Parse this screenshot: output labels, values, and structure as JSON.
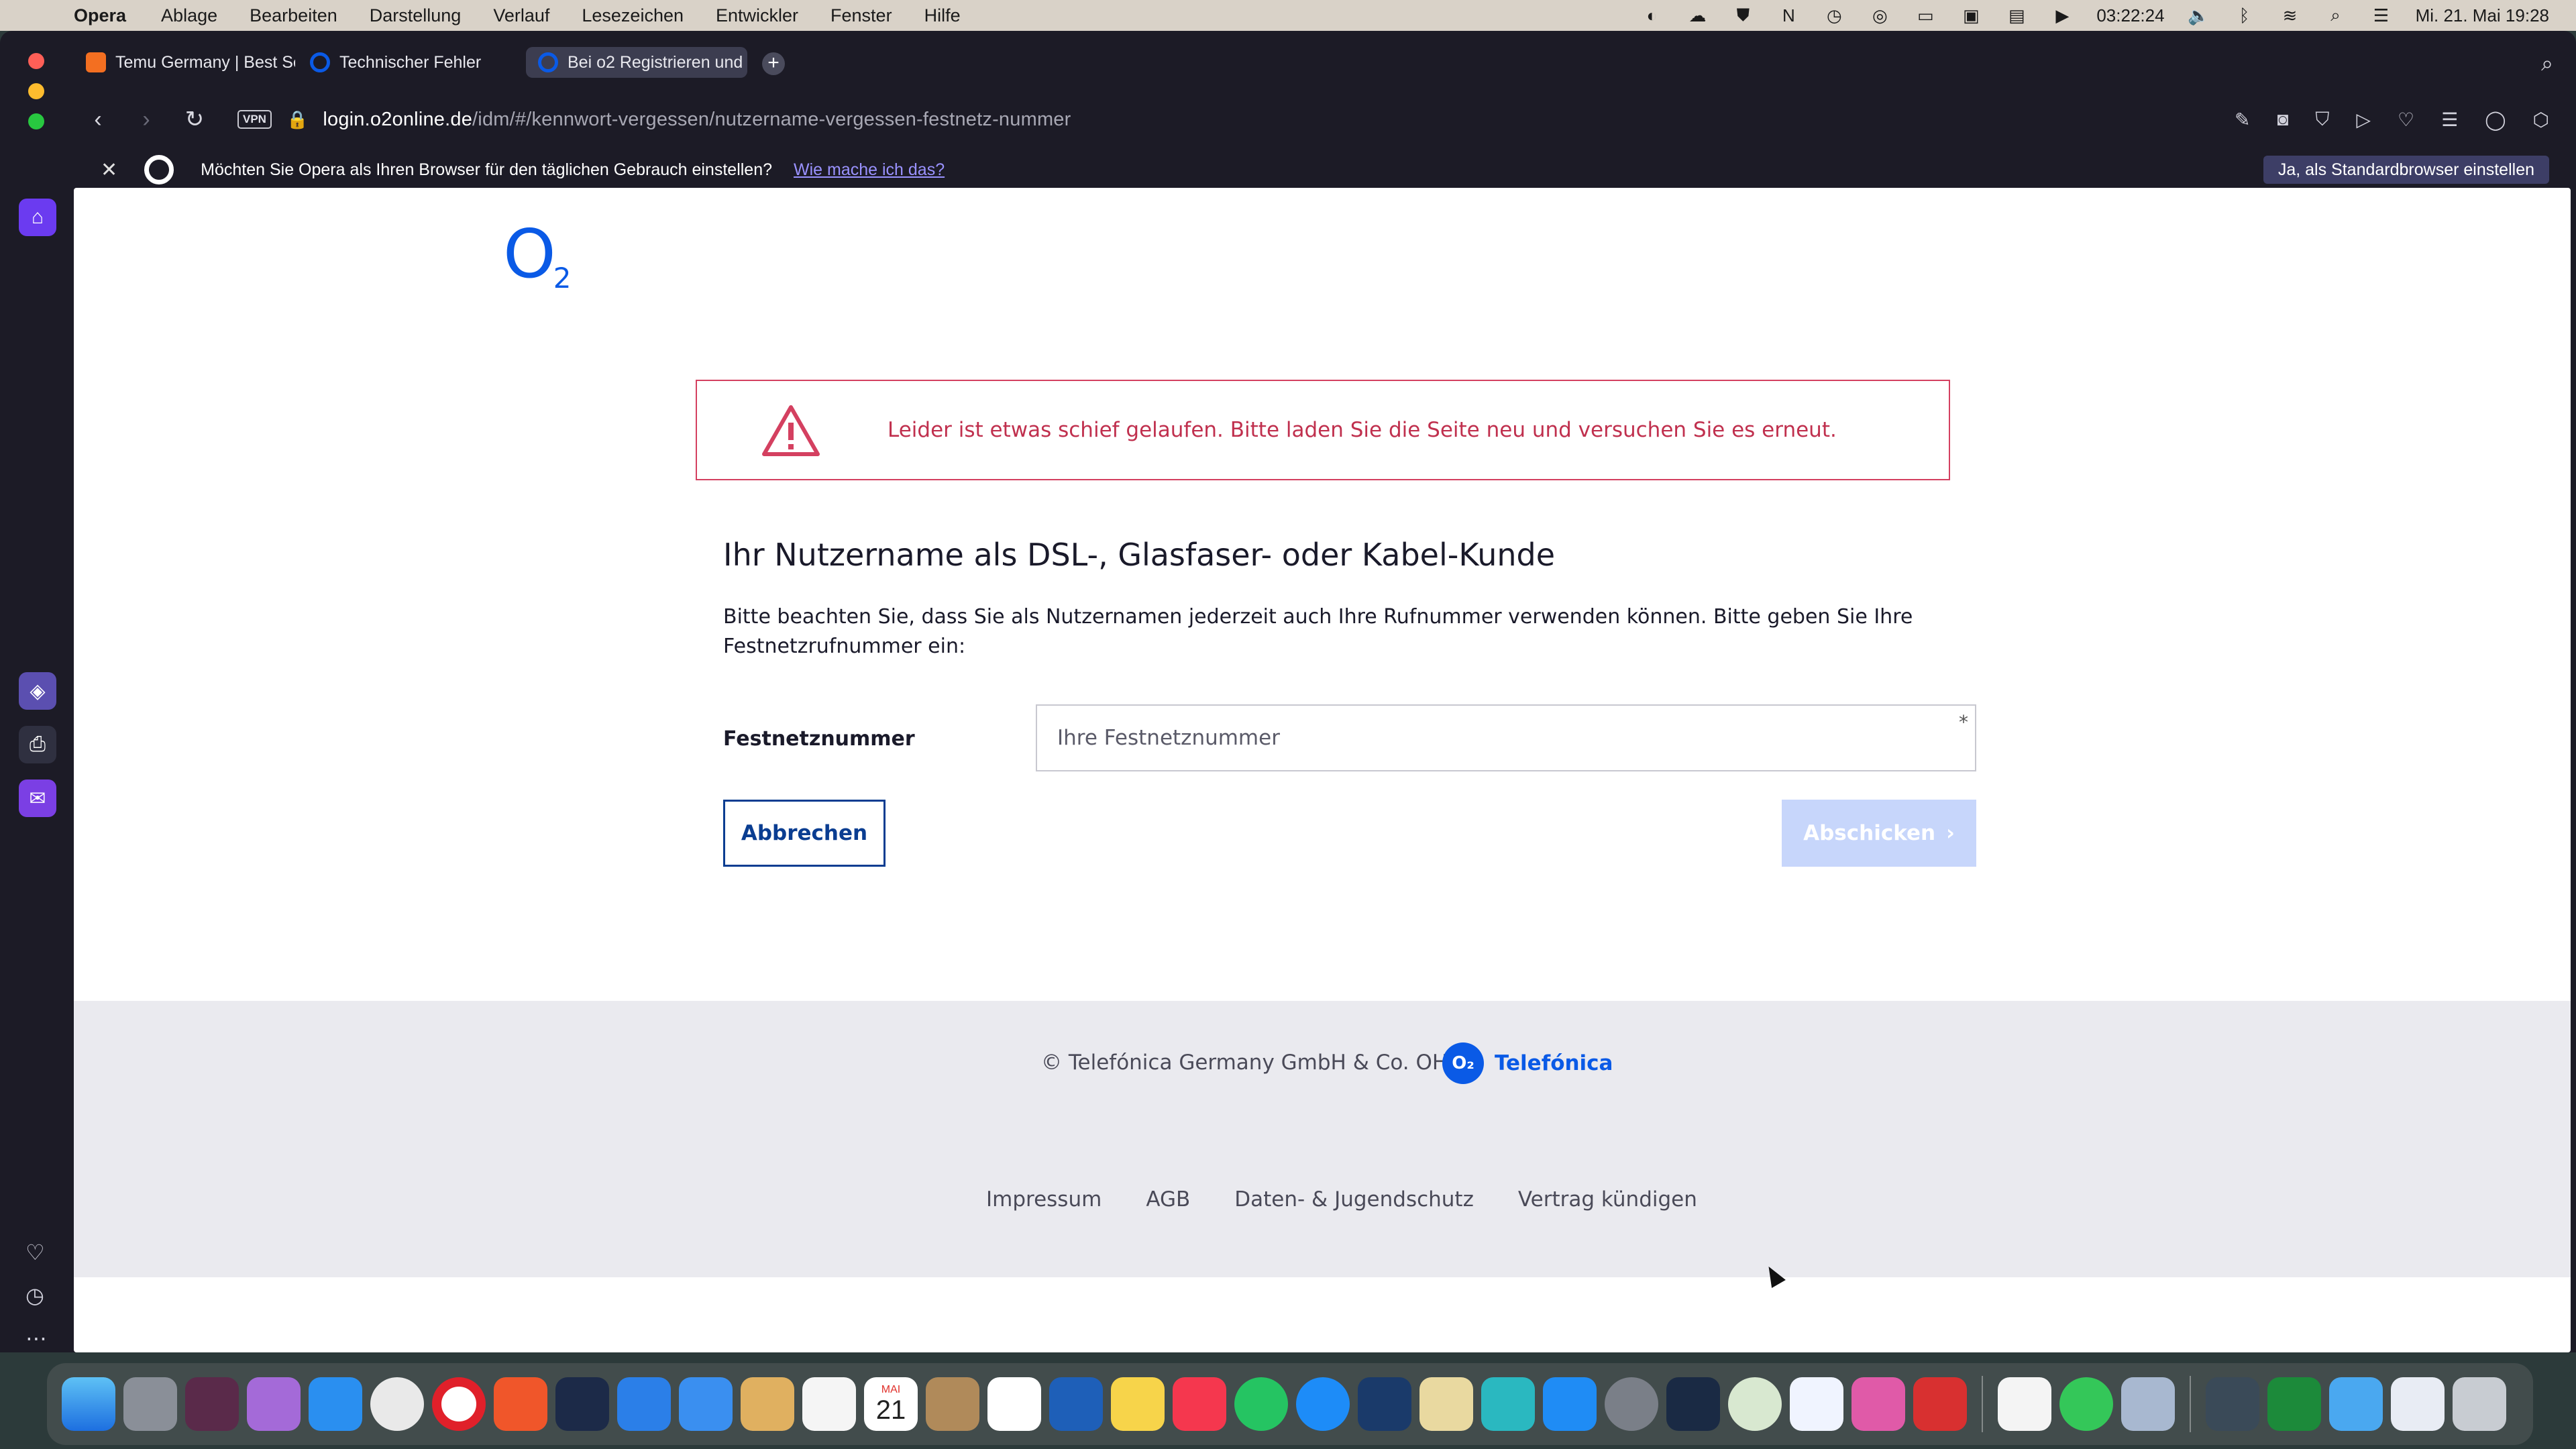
{
  "menubar": {
    "app_name": "Opera",
    "items": [
      "Ablage",
      "Bearbeiten",
      "Darstellung",
      "Verlauf",
      "Lesezeichen",
      "Entwickler",
      "Fenster",
      "Hilfe"
    ],
    "timer": "03:22:24",
    "clock": "Mi. 21. Mai  19:28"
  },
  "tabs": [
    {
      "title": "Temu Germany | Best Se",
      "favicon_color": "#f36f21"
    },
    {
      "title": "Technischer Fehler",
      "favicon_color": "#0a5ae6"
    },
    {
      "title": "Bei o2 Registrieren und",
      "favicon_color": "#0a5ae6"
    }
  ],
  "address": {
    "vpn_label": "VPN",
    "url_host": "login.o2online.de",
    "url_path": "/idm/#/kennwort-vergessen/nutzername-vergessen-festnetz-nummer"
  },
  "infobar": {
    "message": "Möchten Sie Opera als Ihren Browser für den täglichen Gebrauch einstellen?",
    "link": "Wie mache ich das?",
    "button": "Ja, als Standardbrowser einstellen"
  },
  "page": {
    "error_message": "Leider ist etwas schief gelaufen. Bitte laden Sie die Seite neu und versuchen Sie es erneut.",
    "title": "Ihr Nutzername als DSL-, Glasfaser- oder Kabel-Kunde",
    "description": "Bitte beachten Sie, dass Sie als Nutzernamen jederzeit auch Ihre Rufnummer verwenden können. Bitte geben Sie Ihre Festnetzrufnummer ein:",
    "field_label": "Festnetznummer",
    "field_placeholder": "Ihre Festnetznummer",
    "required_mark": "*",
    "cancel_label": "Abbrechen",
    "submit_label": "Abschicken"
  },
  "footer": {
    "copyright": "© Telefónica Germany GmbH & Co. OHG",
    "brand_circle": "O₂",
    "brand_name": "Telefónica",
    "links": [
      "Impressum",
      "AGB",
      "Daten- & Jugendschutz",
      "Vertrag kündigen"
    ]
  },
  "dock": {
    "calendar_month": "MAI",
    "calendar_day": "21",
    "icons": [
      "finder-icon",
      "launchpad-icon",
      "stocks-icon",
      "podcasts-icon",
      "safari-icon",
      "chrome-icon",
      "opera-icon",
      "brave-icon",
      "wordpress-icon",
      "todo-icon",
      "mail-icon",
      "recycle-icon",
      "photos-icon",
      "calendar-icon",
      "contacts-icon",
      "reminders-icon",
      "keynote-icon",
      "notes-icon",
      "music-icon",
      "whatsapp-icon",
      "shazam-icon",
      "prime-video-icon",
      "scripts-icon",
      "amazon-music-icon",
      "app-store-icon",
      "system-settings-icon",
      "activity-monitor-icon",
      "robinhood-icon",
      "lightbulb-icon",
      "cleanmymac-icon",
      "parallels-icon",
      "textedit-icon",
      "find-my-icon",
      "preview-icon",
      "image-capture-icon",
      "luxe-icon",
      "folder-icon",
      "mail-draft-icon",
      "trash-icon"
    ]
  },
  "colors": {
    "o2_blue": "#0a5ae6",
    "error_red": "#d44060",
    "opera_purple": "#6b3bf0"
  }
}
